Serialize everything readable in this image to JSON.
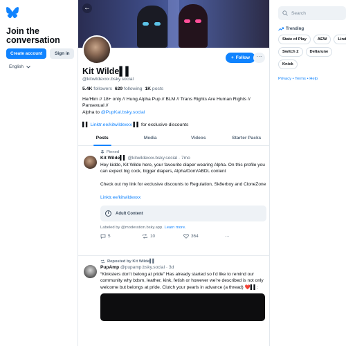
{
  "left": {
    "join_title": "Join the conversation",
    "create_account": "Create account",
    "sign_in": "Sign in",
    "language": "English"
  },
  "profile": {
    "display_name": "Kit Wilde▌▌",
    "handle": "@kitwildexxx.bsky.social",
    "followers_count": "5.4K",
    "followers_label": "followers",
    "following_count": "629",
    "following_label": "following",
    "posts_count": "1K",
    "posts_label": "posts",
    "bio_line1": "He/Him // 18+ only // Hung Alpha Pup // BLM // Trans Rights Are Human Rights // Pansexual //",
    "bio_alpha_prefix": "Alpha to ",
    "bio_alpha_link": "@PupKal.bsky.social",
    "bio_link_prefix": "▌▌ ",
    "bio_link": "Linktr.ee/kitwildexxx",
    "bio_link_suffix": " ▌▌ for exclusive discounts",
    "follow_label": "Follow"
  },
  "tabs": [
    "Posts",
    "Media",
    "Videos",
    "Starter Packs"
  ],
  "post1": {
    "pinned_label": "Pinned",
    "author": "Kit Wilde▌▌",
    "handle": "@kitwildexxx.bsky.social",
    "time": "· 7mo",
    "text1": "Hey kiddo, Kit Wilde here, your favourite diaper wearing Alpha. On this profile you can expect big cock, bigger diapers, Alpha/Dom/ABDL content",
    "text2": "Check out my link for exclusive discounts to Regulation, Sk8erboy and CloneZone",
    "link": "Linktr.ee/kitwildexxx",
    "adult_label": "Adult Content",
    "labeled_by": "Labeled by @moderation.bsky.app.",
    "learn_more": "Learn more.",
    "replies": "5",
    "reposts": "10",
    "likes": "364"
  },
  "post2": {
    "repost_label": "Reposted by Kit Wilde▌▌",
    "author": "PupAmp",
    "handle": "@pupamp.bsky.social",
    "time": "· 3d",
    "text": "“Kinksters don’t belong at pride” Has already started so I’d like to remind our community why bdsm, leather, kink, fetish or however we’re described is not only welcome but belongs at pride. Clutch your pearls in advance (a thread) ❤️▌▌:"
  },
  "right": {
    "search_placeholder": "Search",
    "trending_label": "Trending",
    "trends": [
      "State of Play",
      "AEW",
      "Linda",
      "Switch 2",
      "Deltarune",
      "Knick"
    ],
    "footer_privacy": "Privacy",
    "footer_terms": "Terms",
    "footer_help": "Help",
    "footer_sep": " • "
  },
  "colors": {
    "accent": "#1083fe",
    "muted": "#5b6b7c",
    "border": "#e3e8ed"
  }
}
